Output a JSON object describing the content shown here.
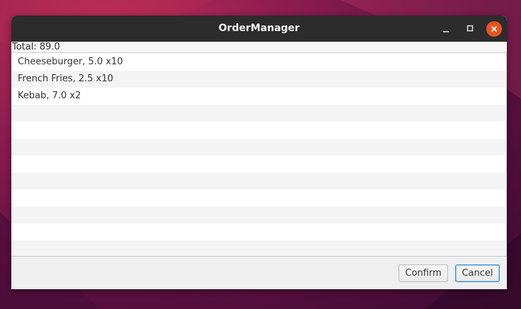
{
  "window": {
    "title": "OrderManager"
  },
  "titlebar_buttons": {
    "minimize_icon": "minimize-icon",
    "maximize_icon": "maximize-icon",
    "close_icon": "close-icon",
    "close_color": "#e95420"
  },
  "order": {
    "total_text": "Total: 89.0",
    "items": [
      "Cheeseburger, 5.0 x10",
      "French Fries, 2.5 x10",
      "Kebab, 7.0 x2"
    ]
  },
  "actions": {
    "confirm_label": "Confirm",
    "cancel_label": "Cancel"
  },
  "colors": {
    "titlebar": "#2c2c2c",
    "accent_focus": "#3b8fd6",
    "desktop": "#7a1748"
  }
}
